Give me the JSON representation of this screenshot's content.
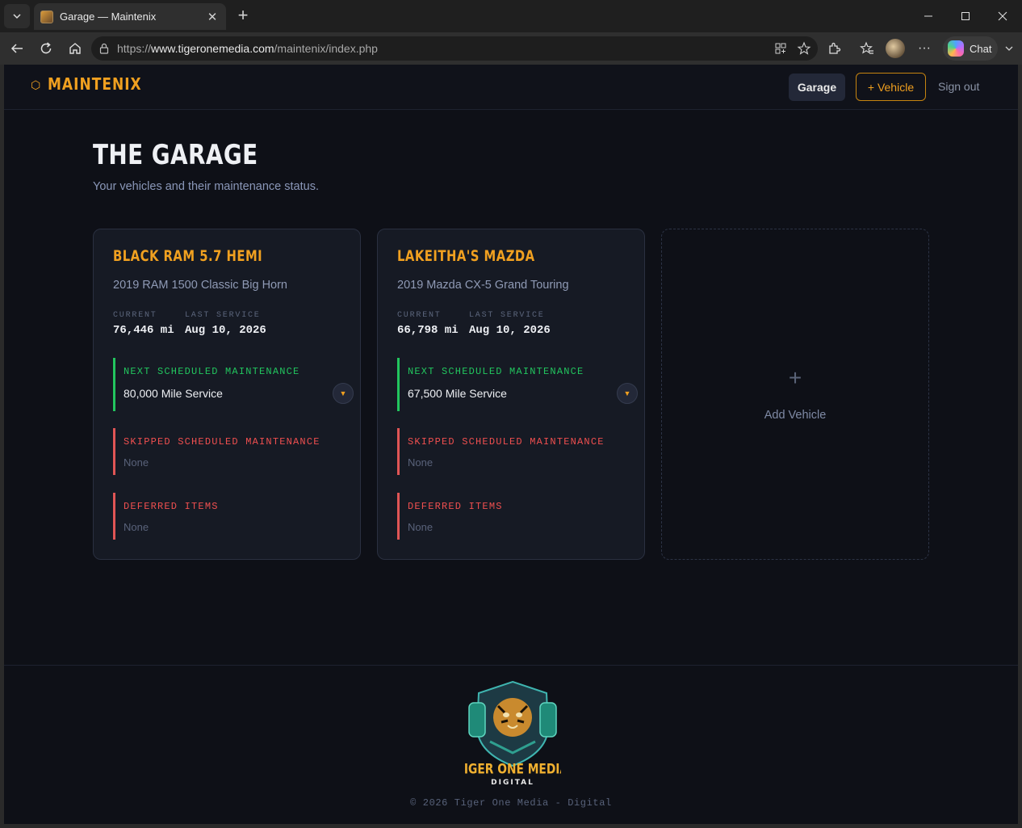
{
  "browser": {
    "tab_title": "Garage — Maintenix",
    "url_scheme": "https://",
    "url_host": "www.tigeronemedia.com",
    "url_path": "/maintenix/index.php",
    "chat_label": "Chat"
  },
  "header": {
    "logo_text": "MAINTENIX",
    "nav_garage": "Garage",
    "nav_add_vehicle": "+ Vehicle",
    "nav_signout": "Sign out"
  },
  "page": {
    "title": "THE GARAGE",
    "subtitle": "Your vehicles and their maintenance status."
  },
  "vehicles": [
    {
      "name": "BLACK RAM 5.7 HEMI",
      "model": "2019 RAM 1500 Classic Big Horn",
      "current_label": "CURRENT",
      "current_value": "76,446 mi",
      "last_service_label": "LAST SERVICE",
      "last_service_value": "Aug 10, 2026",
      "next_label": "NEXT SCHEDULED MAINTENANCE",
      "next_value": "80,000 Mile Service",
      "skipped_label": "SKIPPED SCHEDULED MAINTENANCE",
      "skipped_value": "None",
      "deferred_label": "DEFERRED ITEMS",
      "deferred_value": "None"
    },
    {
      "name": "LAKEITHA'S MAZDA",
      "model": "2019 Mazda CX-5 Grand Touring",
      "current_label": "CURRENT",
      "current_value": "66,798 mi",
      "last_service_label": "LAST SERVICE",
      "last_service_value": "Aug 10, 2026",
      "next_label": "NEXT SCHEDULED MAINTENANCE",
      "next_value": "67,500 Mile Service",
      "skipped_label": "SKIPPED SCHEDULED MAINTENANCE",
      "skipped_value": "None",
      "deferred_label": "DEFERRED ITEMS",
      "deferred_value": "None"
    }
  ],
  "add_card": {
    "plus": "+",
    "label": "Add Vehicle"
  },
  "footer": {
    "logo_title": "TIGER ONE MEDIA",
    "logo_subtitle": "DIGITAL",
    "copyright": "© 2026 Tiger One Media - Digital"
  },
  "colors": {
    "accent": "#f0a020",
    "ok": "#22c55e",
    "alert": "#ef4f4f",
    "background": "#0e1017",
    "card": "#161a24"
  },
  "icons": [
    "tab-list-icon",
    "close-icon",
    "plus-icon",
    "minimize-icon",
    "maximize-icon",
    "back-icon",
    "refresh-icon",
    "home-icon",
    "lock-icon",
    "split-screen-icon",
    "favorite-star-icon",
    "extensions-icon",
    "favorites-icon",
    "profile-avatar",
    "more-icon",
    "chevron-down-icon",
    "hexagon-icon"
  ]
}
